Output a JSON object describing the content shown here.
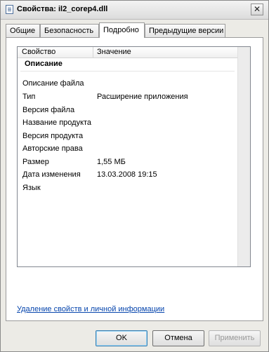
{
  "window": {
    "title": "Свойства: il2_corep4.dll",
    "close_symbol": "✕"
  },
  "tabs": [
    {
      "label": "Общие"
    },
    {
      "label": "Безопасность"
    },
    {
      "label": "Подробно"
    },
    {
      "label": "Предыдущие версии"
    }
  ],
  "columns": {
    "property": "Свойство",
    "value": "Значение"
  },
  "group": "Описание",
  "rows": [
    {
      "name": "Описание файла",
      "value": ""
    },
    {
      "name": "Тип",
      "value": "Расширение приложения"
    },
    {
      "name": "Версия файла",
      "value": ""
    },
    {
      "name": "Название продукта",
      "value": ""
    },
    {
      "name": "Версия продукта",
      "value": ""
    },
    {
      "name": "Авторские права",
      "value": ""
    },
    {
      "name": "Размер",
      "value": "1,55 МБ"
    },
    {
      "name": "Дата изменения",
      "value": "13.03.2008 19:15"
    },
    {
      "name": "Язык",
      "value": ""
    }
  ],
  "link": "Удаление свойств и личной информации",
  "buttons": {
    "ok": "OK",
    "cancel": "Отмена",
    "apply": "Применить"
  }
}
